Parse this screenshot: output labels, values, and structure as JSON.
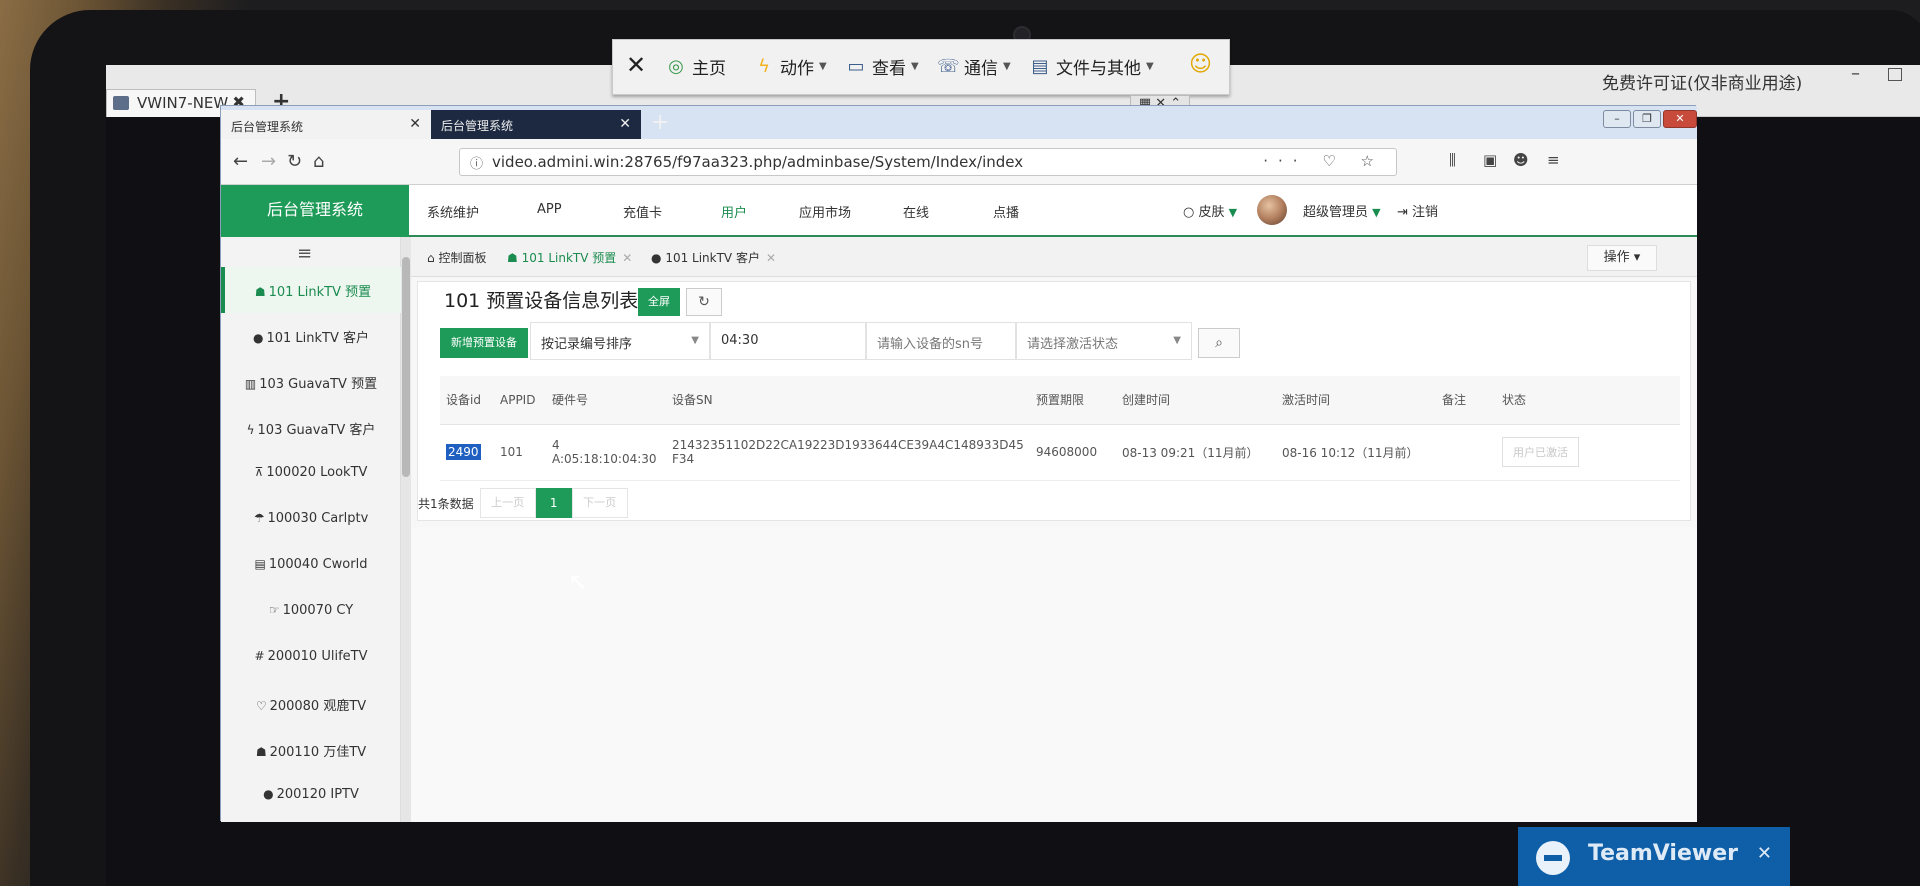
{
  "vnc": {
    "tab_title": "VWIN7-NEW",
    "tab_close": "✖",
    "new_tab": "+",
    "license_text": "免费许可证(仅非商业用途)"
  },
  "remote_toolbar": {
    "close": "✕",
    "home": "主页",
    "action": "动作",
    "view": "查看",
    "communicate": "通信",
    "files": "文件与其他",
    "emoji": "☺"
  },
  "browser": {
    "tab1_title": "后台管理系统",
    "tab2_title": "后台管理系统",
    "url": "video.admini.win:28765/f97aa323.php/adminbase/System/Index/index"
  },
  "header": {
    "brand": "后台管理系统",
    "nav": [
      "系统维护",
      "APP",
      "充值卡",
      "用户",
      "应用市场",
      "在线",
      "点播"
    ],
    "active_nav": "用户",
    "skin": "皮肤",
    "admin_name": "超级管理员",
    "logout": "注销"
  },
  "sidebar": {
    "toggle": "≡",
    "items": [
      {
        "icon": "android-icon",
        "glyph": "☗",
        "label": "101 LinkTV 预置",
        "active": true
      },
      {
        "icon": "comment-icon",
        "glyph": "●",
        "label": "101 LinkTV 客户",
        "active": false
      },
      {
        "icon": "columns-icon",
        "glyph": "▥",
        "label": "103 GuavaTV 预置",
        "active": false
      },
      {
        "icon": "bolt-icon",
        "glyph": "ϟ",
        "label": "103 GuavaTV 客户",
        "active": false
      },
      {
        "icon": "sitemap-icon",
        "glyph": "⊼",
        "label": "100020 LookTV",
        "active": false
      },
      {
        "icon": "umbrella-icon",
        "glyph": "☂",
        "label": "100030 Carlptv",
        "active": false
      },
      {
        "icon": "paste-icon",
        "glyph": "▤",
        "label": "100040 Cworld",
        "active": false
      },
      {
        "icon": "hand-icon",
        "glyph": "☞",
        "label": "100070 CY",
        "active": false
      },
      {
        "icon": "hashtag-icon",
        "glyph": "#",
        "label": "200010 UlifeTV",
        "active": false
      },
      {
        "icon": "heart-icon",
        "glyph": "♡",
        "label": "200080 观鹿TV",
        "active": false
      },
      {
        "icon": "android-icon",
        "glyph": "☗",
        "label": "200110 万佳TV",
        "active": false
      },
      {
        "icon": "comment-icon",
        "glyph": "●",
        "label": "200120 IPTV",
        "active": false
      }
    ]
  },
  "content_tabs": {
    "home": "控制面板",
    "tab1": "101 LinkTV 预置",
    "tab2": "101 LinkTV 客户",
    "ops": "操作"
  },
  "panel": {
    "title": "101 预置设备信息列表",
    "fullscreen": "全屏",
    "add_button": "新增预置设备",
    "sort_select": "按记录编号排序",
    "time_value": "04:30",
    "sn_placeholder": "请输入设备的sn号",
    "status_placeholder": "请选择激活状态"
  },
  "table": {
    "headers": [
      "设备id",
      "APPID",
      "硬件号",
      "设备SN",
      "预置期限",
      "创建时间",
      "激活时间",
      "备注",
      "状态"
    ],
    "rows": [
      {
        "device_id": "2490",
        "app_id": "101",
        "hardware": "4\nA:05:18:10:04:30",
        "sn": "21432351102D22CA19223D1933644CE39A4C148933D45F34",
        "expiry": "94608000",
        "created": "08-13 09:21（11月前）",
        "activated": "08-16 10:12（11月前）",
        "remark": "",
        "status": "用户已激活"
      }
    ]
  },
  "pager": {
    "summary": "共1条数据",
    "prev": "上一页",
    "current": "1",
    "next": "下一页"
  },
  "teamviewer": {
    "name": "TeamViewer",
    "close": "✕"
  }
}
